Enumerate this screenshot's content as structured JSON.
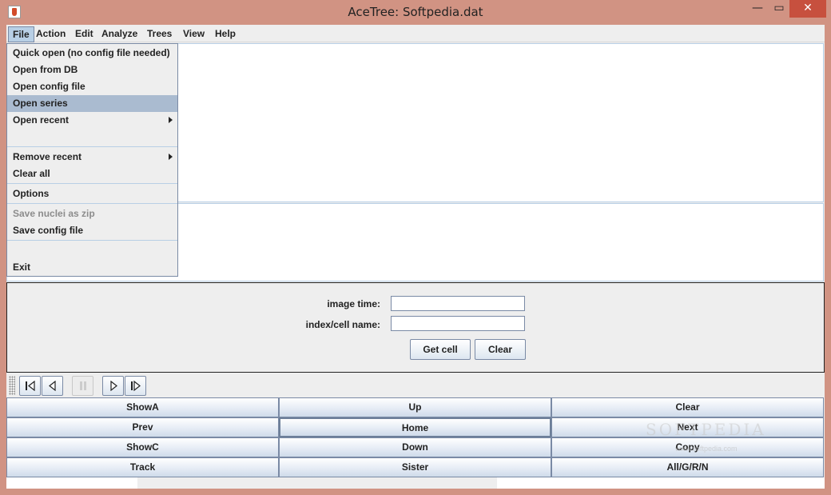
{
  "window": {
    "title": "AceTree: Softpedia.dat",
    "min_glyph": "—",
    "max_glyph": "▭",
    "close_glyph": "✕"
  },
  "menubar": [
    "File",
    "Action",
    "Edit",
    "Analyze",
    "Trees",
    "View",
    "Help"
  ],
  "file_menu": {
    "items": [
      {
        "label": "Quick open (no config file needed)"
      },
      {
        "label": "Open from DB"
      },
      {
        "label": "Open config file"
      },
      {
        "label": "Open series"
      },
      {
        "label": "Open recent"
      },
      {
        "label": "Remove recent"
      },
      {
        "label": "Clear all"
      },
      {
        "label": "Options"
      },
      {
        "label": "Save nuclei as zip"
      },
      {
        "label": "Save config file"
      },
      {
        "label": "Exit"
      }
    ]
  },
  "form": {
    "image_time_label": "image time:",
    "image_time_value": "",
    "index_label": "index/cell name:",
    "index_value": "",
    "get_cell": "Get cell",
    "clear": "Clear"
  },
  "grid": [
    [
      "ShowA",
      "Up",
      "Clear"
    ],
    [
      "Prev",
      "Home",
      "Next"
    ],
    [
      "ShowC",
      "Down",
      "Copy"
    ],
    [
      "Track",
      "Sister",
      "All/G/R/N"
    ]
  ],
  "watermark": {
    "main": "SOFTPEDIA",
    "sub": "www.softpedia.com"
  }
}
